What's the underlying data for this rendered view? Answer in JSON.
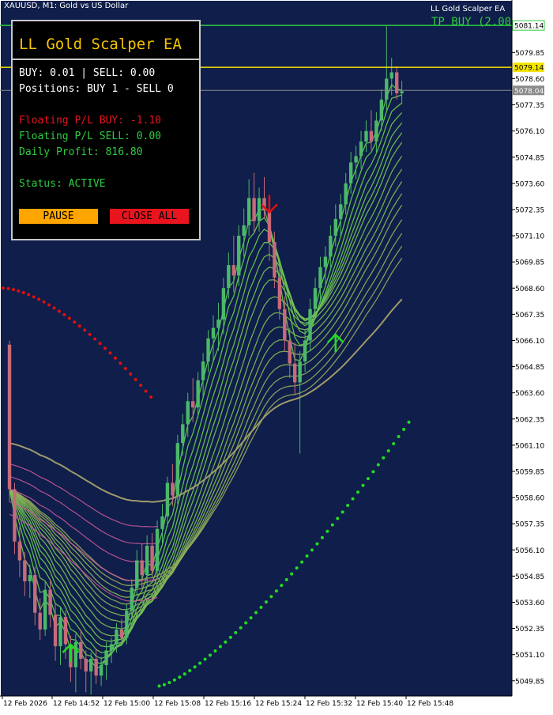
{
  "window": {
    "title": "XAUUSD, M1:  Gold vs US Dollar",
    "ea_label": "LL Gold Scalper EA",
    "tp_label": "TP BUY (2.00"
  },
  "panel": {
    "title": "LL Gold Scalper EA",
    "lots": "BUY: 0.01 | SELL: 0.00",
    "positions": "Positions: BUY 1 - SELL 0",
    "floating_buy": "Floating P/L BUY: -1.10",
    "floating_sell": "Floating P/L SELL: 0.00",
    "daily_profit": "Daily Profit: 816.80",
    "status": "Status: ACTIVE",
    "pause_label": "PAUSE",
    "close_all_label": "CLOSE ALL"
  },
  "colors": {
    "chart_bg": "#0f1e4a",
    "bull": "#4cb86a",
    "bear": "#c86a7a",
    "panel_title": "#f5c400",
    "loss": "#e8141e",
    "profit": "#2ecc40",
    "tp_line": "#2ecc40",
    "bid_line": "#f5e600"
  },
  "chart_data": {
    "type": "candlestick",
    "y_ticks": [
      "5079.85",
      "5078.60",
      "5077.35",
      "5076.10",
      "5074.85",
      "5073.60",
      "5072.35",
      "5071.10",
      "5069.85",
      "5068.60",
      "5067.35",
      "5066.10",
      "5064.85",
      "5063.60",
      "5062.35",
      "5061.10",
      "5059.85",
      "5058.60",
      "5057.35",
      "5056.10",
      "5054.85",
      "5053.60",
      "5052.35",
      "5051.10",
      "5049.85"
    ],
    "x_ticks": [
      "12 Feb 2026",
      "12 Feb 14:52",
      "12 Feb 15:00",
      "12 Feb 15:08",
      "12 Feb 15:16",
      "12 Feb 15:24",
      "12 Feb 15:32",
      "12 Feb 15:40",
      "12 Feb 15:48"
    ],
    "ylim": [
      5049.2,
      5081.6
    ],
    "price_tags": [
      {
        "label": "5081.14",
        "value": 5081.14,
        "kind": "tp"
      },
      {
        "label": "5079.14",
        "value": 5079.14,
        "kind": "bid"
      },
      {
        "label": "5078.04",
        "value": 5078.04,
        "kind": "ask"
      }
    ],
    "candles": [
      [
        5065.9,
        5066.1,
        5058.4,
        5059.0
      ],
      [
        5059.0,
        5059.3,
        5055.9,
        5056.5
      ],
      [
        5056.5,
        5057.2,
        5054.8,
        5055.6
      ],
      [
        5055.6,
        5056.0,
        5053.9,
        5054.6
      ],
      [
        5054.6,
        5055.4,
        5053.8,
        5054.9
      ],
      [
        5054.9,
        5055.3,
        5052.5,
        5053.1
      ],
      [
        5053.1,
        5053.8,
        5051.8,
        5052.3
      ],
      [
        5052.3,
        5054.6,
        5052.0,
        5054.2
      ],
      [
        5054.2,
        5054.7,
        5052.4,
        5053.0
      ],
      [
        5053.0,
        5053.5,
        5050.8,
        5051.5
      ],
      [
        5051.5,
        5053.4,
        5050.6,
        5052.9
      ],
      [
        5052.9,
        5053.2,
        5050.9,
        5051.6
      ],
      [
        5051.6,
        5052.0,
        5049.8,
        5050.5
      ],
      [
        5050.5,
        5052.1,
        5049.3,
        5051.7
      ],
      [
        5051.7,
        5052.3,
        5050.4,
        5050.9
      ],
      [
        5050.9,
        5051.3,
        5049.3,
        5050.3
      ],
      [
        5050.3,
        5051.2,
        5049.2,
        5050.9
      ],
      [
        5050.9,
        5051.4,
        5049.7,
        5050.1
      ],
      [
        5050.1,
        5051.0,
        5049.6,
        5050.6
      ],
      [
        5050.6,
        5051.7,
        5049.9,
        5051.3
      ],
      [
        5051.3,
        5051.9,
        5050.7,
        5051.6
      ],
      [
        5051.6,
        5052.6,
        5051.2,
        5052.3
      ],
      [
        5052.3,
        5052.8,
        5051.6,
        5051.9
      ],
      [
        5051.9,
        5053.5,
        5051.6,
        5053.2
      ],
      [
        5053.2,
        5054.7,
        5052.9,
        5054.3
      ],
      [
        5054.3,
        5056.1,
        5053.9,
        5055.6
      ],
      [
        5055.6,
        5056.4,
        5054.3,
        5054.9
      ],
      [
        5054.9,
        5056.8,
        5054.4,
        5056.3
      ],
      [
        5056.3,
        5056.9,
        5054.8,
        5055.1
      ],
      [
        5055.1,
        5057.5,
        5054.7,
        5057.1
      ],
      [
        5057.1,
        5058.3,
        5056.4,
        5057.7
      ],
      [
        5057.7,
        5059.6,
        5057.2,
        5059.3
      ],
      [
        5059.3,
        5060.2,
        5058.2,
        5058.7
      ],
      [
        5058.7,
        5061.6,
        5058.3,
        5061.2
      ],
      [
        5061.2,
        5062.6,
        5060.6,
        5062.1
      ],
      [
        5062.1,
        5063.6,
        5061.5,
        5063.2
      ],
      [
        5063.2,
        5064.3,
        5062.2,
        5062.9
      ],
      [
        5062.9,
        5064.6,
        5062.4,
        5064.2
      ],
      [
        5064.2,
        5065.5,
        5063.4,
        5065.1
      ],
      [
        5065.1,
        5066.6,
        5064.6,
        5066.2
      ],
      [
        5066.2,
        5067.3,
        5065.1,
        5066.7
      ],
      [
        5066.7,
        5067.9,
        5065.6,
        5067.1
      ],
      [
        5067.1,
        5069.1,
        5066.4,
        5068.6
      ],
      [
        5068.6,
        5070.3,
        5068.1,
        5069.7
      ],
      [
        5069.7,
        5071.1,
        5068.4,
        5069.2
      ],
      [
        5069.2,
        5071.6,
        5068.7,
        5071.1
      ],
      [
        5071.1,
        5072.4,
        5070.1,
        5071.6
      ],
      [
        5071.6,
        5073.8,
        5071.1,
        5072.9
      ],
      [
        5072.9,
        5074.1,
        5071.2,
        5071.8
      ],
      [
        5071.8,
        5073.4,
        5071.3,
        5072.9
      ],
      [
        5072.9,
        5073.9,
        5071.9,
        5072.3
      ],
      [
        5072.3,
        5072.8,
        5069.9,
        5070.8
      ],
      [
        5070.8,
        5071.3,
        5068.6,
        5069.1
      ],
      [
        5069.1,
        5069.6,
        5067.1,
        5067.6
      ],
      [
        5067.6,
        5068.2,
        5065.6,
        5066.1
      ],
      [
        5066.1,
        5066.7,
        5064.3,
        5065.0
      ],
      [
        5065.0,
        5066.0,
        5063.5,
        5064.1
      ],
      [
        5064.1,
        5065.6,
        5060.7,
        5065.1
      ],
      [
        5065.1,
        5066.6,
        5064.6,
        5066.1
      ],
      [
        5066.1,
        5068.1,
        5065.6,
        5067.6
      ],
      [
        5067.6,
        5069.1,
        5067.1,
        5068.6
      ],
      [
        5068.6,
        5070.1,
        5067.9,
        5069.6
      ],
      [
        5069.6,
        5070.6,
        5068.8,
        5070.1
      ],
      [
        5070.1,
        5071.6,
        5069.6,
        5071.1
      ],
      [
        5071.1,
        5072.6,
        5070.6,
        5071.9
      ],
      [
        5071.9,
        5073.1,
        5071.1,
        5072.6
      ],
      [
        5072.6,
        5074.1,
        5072.1,
        5073.6
      ],
      [
        5073.6,
        5075.1,
        5073.1,
        5074.6
      ],
      [
        5074.6,
        5075.4,
        5073.8,
        5074.9
      ],
      [
        5074.9,
        5076.1,
        5074.3,
        5075.6
      ],
      [
        5075.6,
        5076.6,
        5075.1,
        5076.1
      ],
      [
        5076.1,
        5077.1,
        5075.2,
        5075.6
      ],
      [
        5075.6,
        5077.0,
        5075.1,
        5076.6
      ],
      [
        5076.6,
        5078.1,
        5076.1,
        5077.6
      ],
      [
        5077.6,
        5081.1,
        5077.1,
        5078.6
      ],
      [
        5078.6,
        5079.6,
        5077.8,
        5078.9
      ],
      [
        5078.9,
        5079.2,
        5077.6,
        5077.9
      ],
      [
        5077.9,
        5078.5,
        5077.4,
        5078.0
      ]
    ],
    "markers": [
      {
        "type": "sell_arrow",
        "index": 51,
        "price": 5072.6
      },
      {
        "type": "buy_arrow",
        "index": 12,
        "price": 5051.2
      },
      {
        "type": "buy_arrow",
        "index": 64,
        "price": 5066.0
      }
    ]
  }
}
